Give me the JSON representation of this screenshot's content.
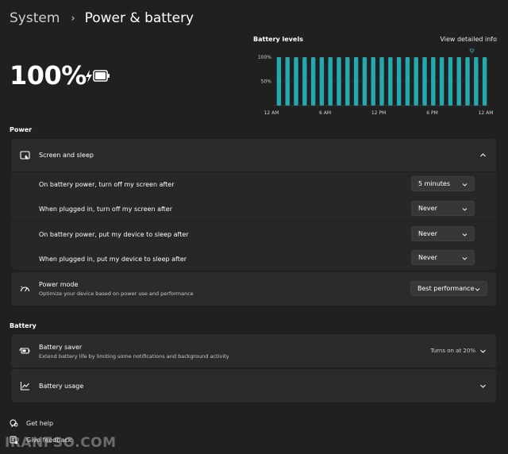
{
  "breadcrumb": {
    "parent": "System",
    "separator": "›",
    "current": "Power & battery"
  },
  "battery": {
    "percent_label": "100%",
    "level": 1.0,
    "charging": true
  },
  "chart_data": {
    "type": "bar",
    "title": "Battery levels",
    "link_label": "View detailed info",
    "y_ticks": [
      "100%",
      "50%"
    ],
    "x_ticks": [
      "12 AM",
      "6 AM",
      "12 PM",
      "6 PM",
      "12 AM"
    ],
    "ylim": [
      0,
      100
    ],
    "values": [
      100,
      100,
      100,
      100,
      100,
      100,
      100,
      100,
      100,
      100,
      100,
      100,
      100,
      100,
      100,
      100,
      100,
      100,
      100,
      100,
      100,
      100,
      100,
      100,
      100
    ],
    "bar_color": "#25a9b0",
    "grid": true
  },
  "sections": {
    "power": "Power",
    "battery": "Battery"
  },
  "screen_sleep": {
    "title": "Screen and sleep",
    "rows": [
      {
        "label": "On battery power, turn off my screen after",
        "value": "5 minutes"
      },
      {
        "label": "When plugged in, turn off my screen after",
        "value": "Never"
      },
      {
        "label": "On battery power, put my device to sleep after",
        "value": "Never"
      },
      {
        "label": "When plugged in, put my device to sleep after",
        "value": "Never"
      }
    ]
  },
  "power_mode": {
    "title": "Power mode",
    "subtitle": "Optimize your device based on power use and performance",
    "value": "Best performance"
  },
  "battery_saver": {
    "title": "Battery saver",
    "subtitle": "Extend battery life by limiting some notifications and background activity",
    "status": "Turns on at 20%"
  },
  "battery_usage": {
    "title": "Battery usage"
  },
  "footer": {
    "help": "Get help",
    "feedback": "Give feedback"
  },
  "watermark": "IRANFSO.COM",
  "icons": {
    "battery": "battery-charging-icon",
    "screen": "screen-sleep-icon",
    "power_mode": "power-mode-icon",
    "saver": "battery-saver-icon",
    "usage": "usage-graph-icon",
    "help": "help-icon",
    "feedback": "feedback-icon"
  }
}
